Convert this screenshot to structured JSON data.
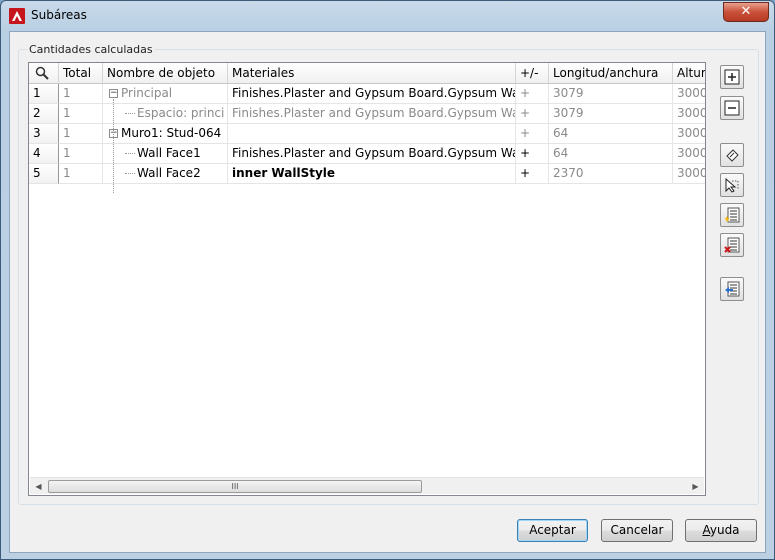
{
  "window": {
    "title": "Subáreas",
    "close_label": "✕"
  },
  "group": {
    "label": "Cantidades calculadas"
  },
  "grid": {
    "headers": {
      "search_icon": "magnifier-icon",
      "total": "Total",
      "nombre": "Nombre de objeto",
      "materiales": "Materiales",
      "signo": "+/-",
      "longitud": "Longitud/anchura",
      "altura": "Altura"
    },
    "rows": [
      {
        "num": "1",
        "total": "1",
        "nombre": "Principal",
        "materiales": "Finishes.Plaster and Gypsum Board.Gypsum Wallboard",
        "signo": "+",
        "longitud": "3079",
        "altura": "3000"
      },
      {
        "num": "2",
        "total": "1",
        "nombre": "Espacio: princi ...",
        "materiales": "Finishes.Plaster and Gypsum Board.Gypsum Wallboard",
        "signo": "+",
        "longitud": "3079",
        "altura": "3000"
      },
      {
        "num": "3",
        "total": "1",
        "nombre": "Muro1: Stud-064",
        "materiales": "",
        "signo": "+",
        "longitud": "64",
        "altura": "3000"
      },
      {
        "num": "4",
        "total": "1",
        "nombre": "Wall Face1",
        "materiales": "Finishes.Plaster and Gypsum Board.Gypsum Wallboard",
        "signo": "+",
        "longitud": "64",
        "altura": "3000"
      },
      {
        "num": "5",
        "total": "1",
        "nombre": "Wall Face2",
        "materiales": "inner WallStyle",
        "signo": "+",
        "longitud": "2370",
        "altura": "3000"
      }
    ],
    "scroll_thumb_grip": "III"
  },
  "buttons": {
    "aceptar": "Aceptar",
    "cancelar": "Cancelar",
    "ayuda_first": "A",
    "ayuda_rest": "yuda"
  }
}
